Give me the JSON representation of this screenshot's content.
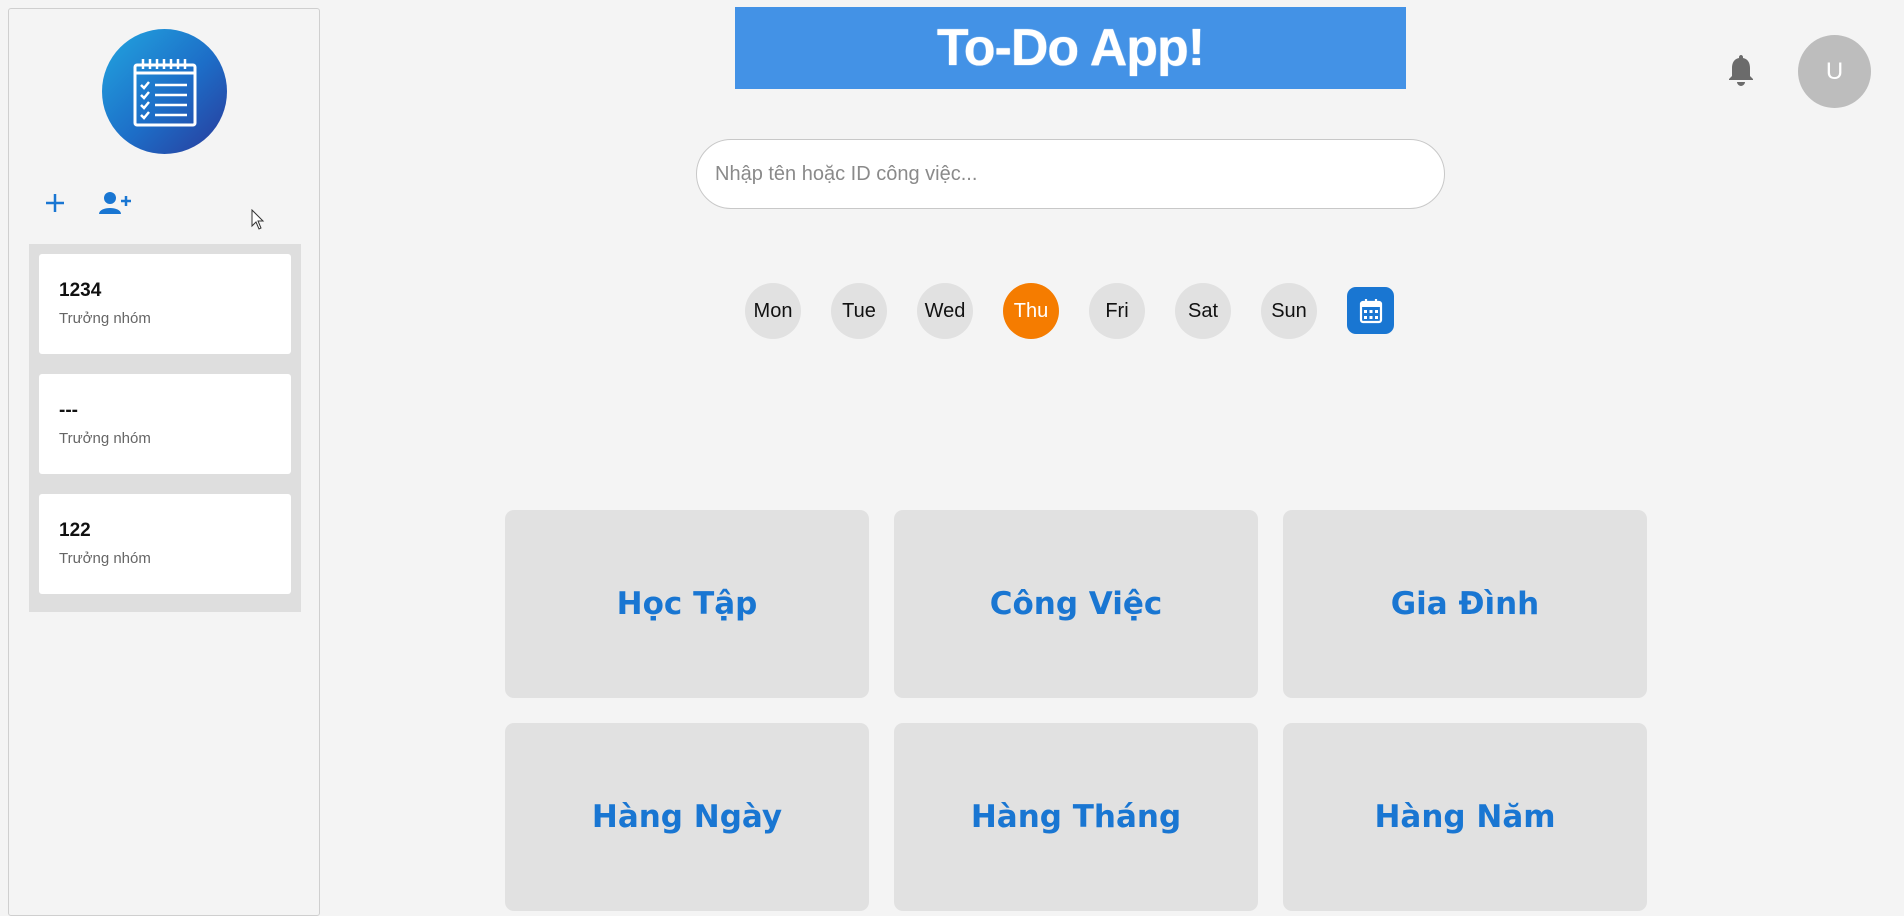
{
  "header": {
    "title": "To-Do App!",
    "avatar_letter": "U"
  },
  "search": {
    "placeholder": "Nhập tên hoặc ID công việc..."
  },
  "days": [
    {
      "label": "Mon",
      "active": false
    },
    {
      "label": "Tue",
      "active": false
    },
    {
      "label": "Wed",
      "active": false
    },
    {
      "label": "Thu",
      "active": true
    },
    {
      "label": "Fri",
      "active": false
    },
    {
      "label": "Sat",
      "active": false
    },
    {
      "label": "Sun",
      "active": false
    }
  ],
  "groups": [
    {
      "name": "1234",
      "role": "Trưởng nhóm"
    },
    {
      "name": "---",
      "role": "Trưởng nhóm"
    },
    {
      "name": "122",
      "role": "Trưởng nhóm"
    }
  ],
  "categories": [
    "Học Tập",
    "Công Việc",
    "Gia Đình",
    "Hàng Ngày",
    "Hàng Tháng",
    "Hàng Năm"
  ],
  "colors": {
    "accent": "#1976d2",
    "active_day": "#f57c00",
    "banner": "#4392e6"
  },
  "icons": [
    "notepad-logo-icon",
    "plus-icon",
    "add-user-icon",
    "bell-icon",
    "calendar-icon",
    "mouse-cursor-icon"
  ]
}
